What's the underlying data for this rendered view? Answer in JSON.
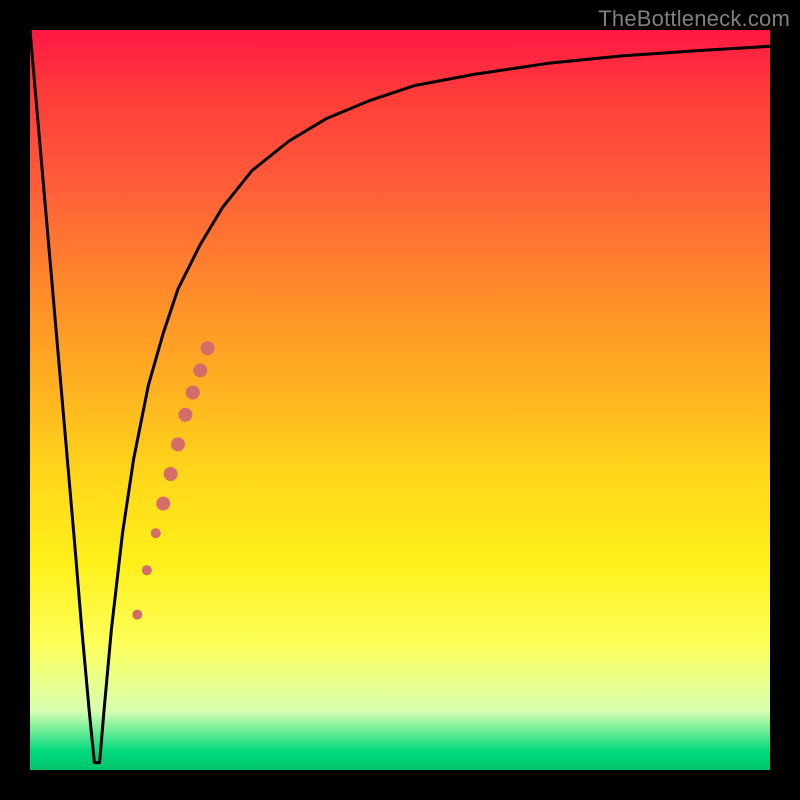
{
  "watermark": "TheBottleneck.com",
  "colors": {
    "frame": "#000000",
    "curve": "#000000",
    "marker": "#d46d6a",
    "gradient_top": "#ff1744",
    "gradient_mid": "#ffd61a",
    "gradient_bottom": "#00c46a"
  },
  "chart_data": {
    "type": "line",
    "title": "",
    "xlabel": "",
    "ylabel": "",
    "xlim": [
      0,
      100
    ],
    "ylim": [
      0,
      100
    ],
    "grid": false,
    "legend": false,
    "description": "Bottleneck percentage curve: a sharp dip to ~0% near a low x value, then asymptotic rise toward ~100%.",
    "series": [
      {
        "name": "bottleneck-curve",
        "x": [
          0,
          2,
          4,
          6,
          7,
          8,
          8.7,
          9.4,
          10,
          11,
          12.5,
          14,
          16,
          18,
          20,
          23,
          26,
          30,
          35,
          40,
          46,
          52,
          60,
          70,
          80,
          90,
          100
        ],
        "y": [
          100,
          77,
          54,
          31,
          19,
          8,
          1,
          1,
          8,
          19,
          32,
          42,
          52,
          59,
          65,
          71,
          76,
          81,
          85,
          88,
          90.5,
          92.5,
          94,
          95.5,
          96.5,
          97.2,
          97.8
        ]
      }
    ],
    "markers": {
      "name": "highlight-segment",
      "color": "#d46d6a",
      "points": [
        {
          "x": 14.5,
          "y": 21,
          "r": 5
        },
        {
          "x": 15.8,
          "y": 27,
          "r": 5
        },
        {
          "x": 17.0,
          "y": 32,
          "r": 5
        },
        {
          "x": 18.0,
          "y": 36,
          "r": 7
        },
        {
          "x": 19.0,
          "y": 40,
          "r": 7
        },
        {
          "x": 20.0,
          "y": 44,
          "r": 7
        },
        {
          "x": 21.0,
          "y": 48,
          "r": 7
        },
        {
          "x": 22.0,
          "y": 51,
          "r": 7
        },
        {
          "x": 23.0,
          "y": 54,
          "r": 7
        },
        {
          "x": 24.0,
          "y": 57,
          "r": 7
        }
      ]
    }
  }
}
